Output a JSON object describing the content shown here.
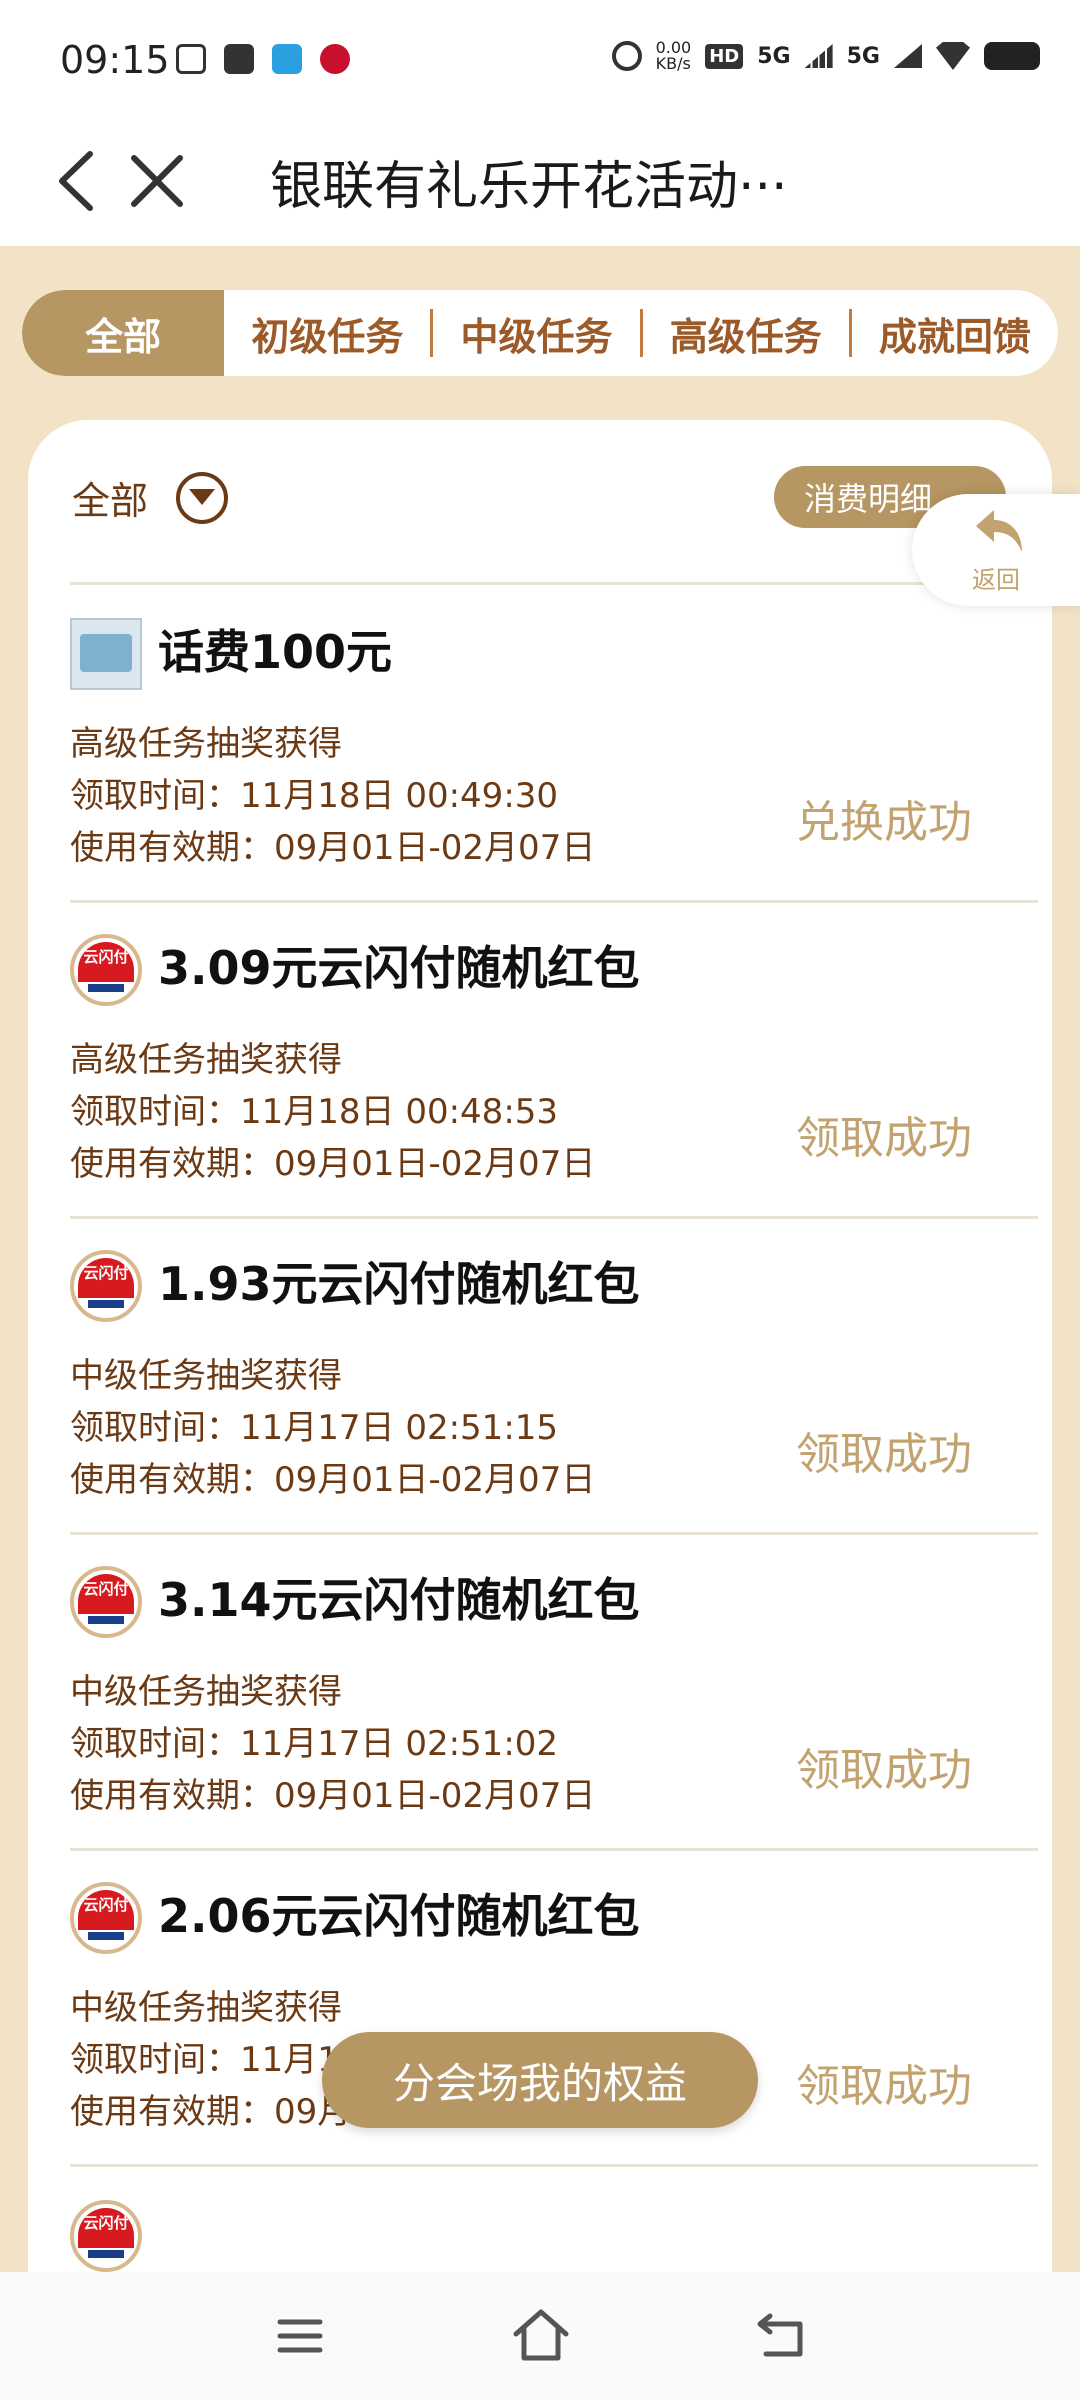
{
  "status_bar": {
    "time": "09:15",
    "net_speed": "0.00\nKB/s",
    "hd": "HD",
    "sig1": "5G",
    "sig2": "5G"
  },
  "header": {
    "title": "银联有礼乐开花活动···"
  },
  "tabs": [
    {
      "label": "全部",
      "active": true
    },
    {
      "label": "初级任务"
    },
    {
      "label": "中级任务"
    },
    {
      "label": "高级任务"
    },
    {
      "label": "成就回馈"
    }
  ],
  "filter": {
    "label": "全部",
    "detail_button": "消费明细"
  },
  "float_back": {
    "label": "返回"
  },
  "items": [
    {
      "name": "话费100元",
      "source": "高级任务抽奖获得",
      "time": "领取时间：11月18日 00:49:30",
      "valid": "使用有效期：09月01日-02月07日",
      "state": "兑换成功"
    },
    {
      "name": "3.09元云闪付随机红包",
      "source": "高级任务抽奖获得",
      "time": "领取时间：11月18日 00:48:53",
      "valid": "使用有效期：09月01日-02月07日",
      "state": "领取成功"
    },
    {
      "name": "1.93元云闪付随机红包",
      "source": "中级任务抽奖获得",
      "time": "领取时间：11月17日 02:51:15",
      "valid": "使用有效期：09月01日-02月07日",
      "state": "领取成功"
    },
    {
      "name": "3.14元云闪付随机红包",
      "source": "中级任务抽奖获得",
      "time": "领取时间：11月17日 02:51:02",
      "valid": "使用有效期：09月01日-02月07日",
      "state": "领取成功"
    },
    {
      "name": "2.06元云闪付随机红包",
      "source": "中级任务抽奖获得",
      "time": "领取时间：11月1",
      "valid": "使用有效期：09月",
      "state": "领取成功"
    }
  ],
  "logo_text": "云闪付",
  "floating_button": "分会场我的权益"
}
